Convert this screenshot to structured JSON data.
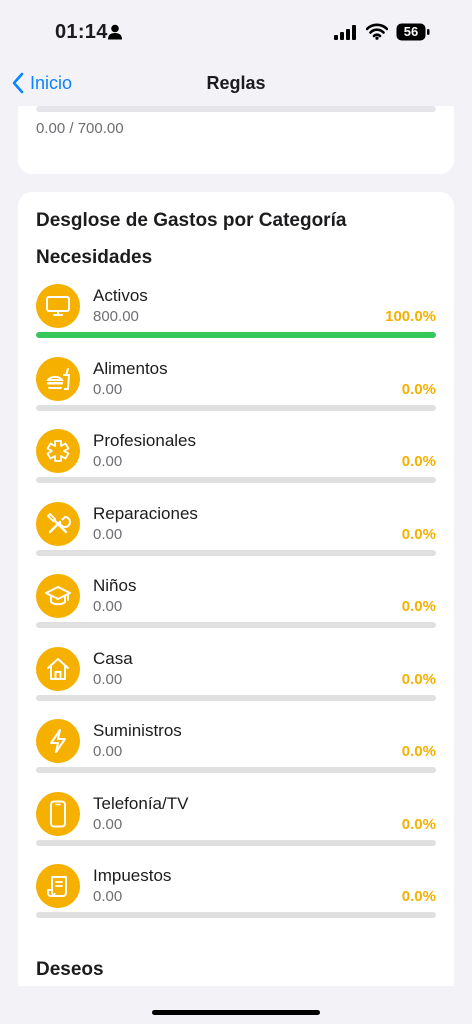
{
  "status_bar": {
    "time": "01:14",
    "battery": "56"
  },
  "nav": {
    "back_label": "Inicio",
    "title": "Reglas"
  },
  "top_card": {
    "amount": "0.00 / 700.00"
  },
  "breakdown": {
    "title": "Desglose de Gastos por Categoría",
    "section_needs": "Necesidades",
    "section_wants": "Deseos",
    "accent_color": "#f5b000",
    "progress_color": "#34c759",
    "categories": [
      {
        "name": "Activos",
        "amount": "800.00",
        "percent": "100.0%",
        "progress": 1.0,
        "icon": "monitor-icon"
      },
      {
        "name": "Alimentos",
        "amount": "0.00",
        "percent": "0.0%",
        "progress": 0,
        "icon": "food-icon"
      },
      {
        "name": "Profesionales",
        "amount": "0.00",
        "percent": "0.0%",
        "progress": 0,
        "icon": "medical-icon"
      },
      {
        "name": "Reparaciones",
        "amount": "0.00",
        "percent": "0.0%",
        "progress": 0,
        "icon": "tools-icon"
      },
      {
        "name": "Niños",
        "amount": "0.00",
        "percent": "0.0%",
        "progress": 0,
        "icon": "graduation-cap-icon"
      },
      {
        "name": "Casa",
        "amount": "0.00",
        "percent": "0.0%",
        "progress": 0,
        "icon": "house-icon"
      },
      {
        "name": "Suministros",
        "amount": "0.00",
        "percent": "0.0%",
        "progress": 0,
        "icon": "bolt-icon"
      },
      {
        "name": "Telefonía/TV",
        "amount": "0.00",
        "percent": "0.0%",
        "progress": 0,
        "icon": "phone-icon"
      },
      {
        "name": "Impuestos",
        "amount": "0.00",
        "percent": "0.0%",
        "progress": 0,
        "icon": "receipt-icon"
      }
    ]
  }
}
